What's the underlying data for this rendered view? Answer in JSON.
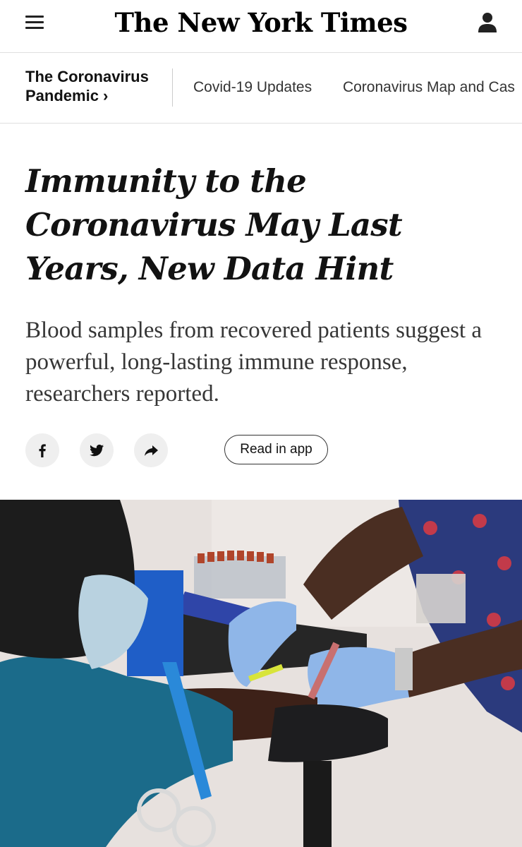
{
  "header": {
    "logo": "The New York Times",
    "menu_icon": "hamburger-menu-icon",
    "account_icon": "user-icon"
  },
  "section_nav": {
    "title": "The Coronavirus Pandemic ›",
    "links": [
      "Covid-19 Updates",
      "Coronavirus Map and Cas"
    ]
  },
  "article": {
    "headline": "Immunity to the Coronavirus May Last Years, New Data Hint",
    "summary": "Blood samples from recovered patients suggest a powerful, long-lasting immune response, researchers reported."
  },
  "share": {
    "icons": [
      "facebook-icon",
      "twitter-icon",
      "share-arrow-icon"
    ],
    "read_in_app_label": "Read in app"
  },
  "colors": {
    "text": "#121212",
    "summary_text": "#363636",
    "divider": "#dfdfdf",
    "share_button_bg": "#efefef"
  }
}
